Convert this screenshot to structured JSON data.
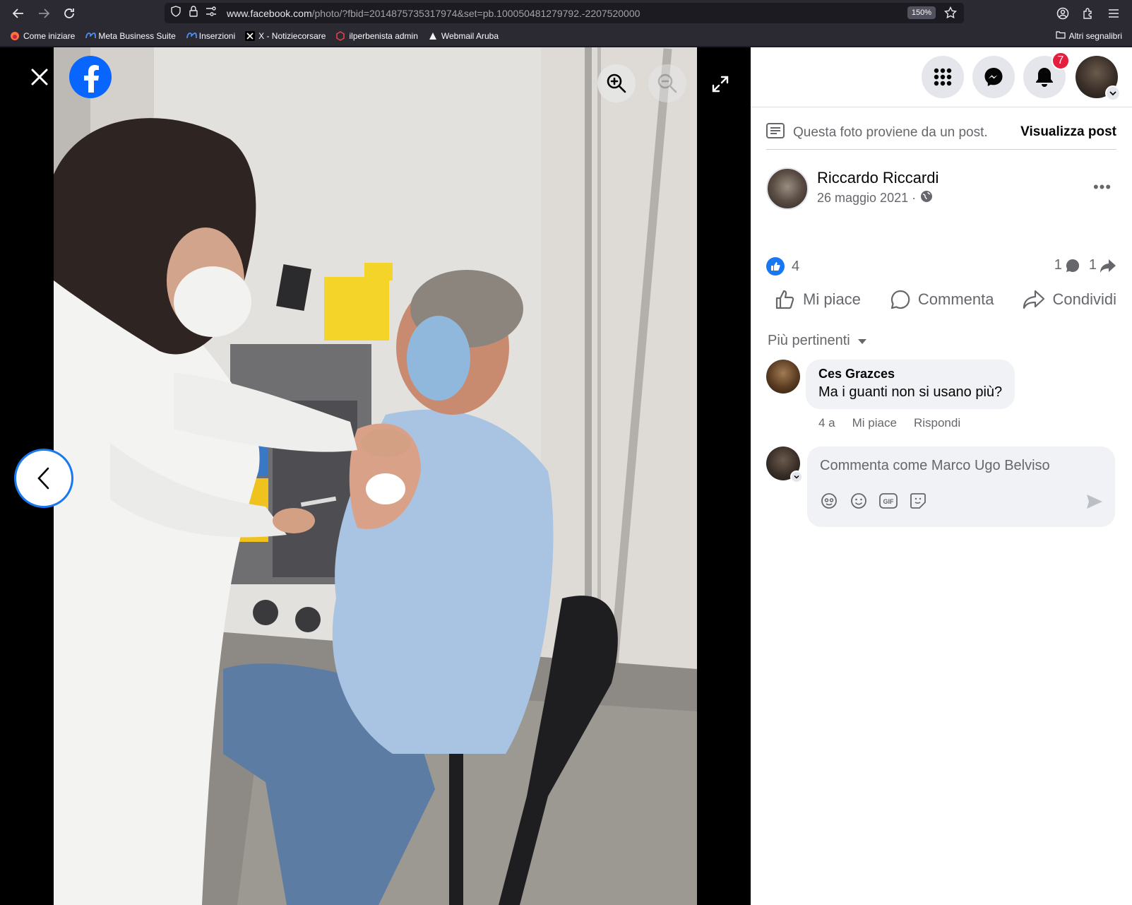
{
  "browser": {
    "url_host": "www.facebook.com",
    "url_path": "/photo/?fbid=2014875735317974&set=pb.100050481279792.-2207520000",
    "zoom": "150%",
    "bookmarks": [
      {
        "label": "Come iniziare"
      },
      {
        "label": "Meta Business Suite"
      },
      {
        "label": "Inserzioni"
      },
      {
        "label": "X - Notiziecorsare"
      },
      {
        "label": "ilperbenista admin"
      },
      {
        "label": "Webmail Aruba"
      }
    ],
    "other_bookmarks": "Altri segnalibri"
  },
  "viewer": {
    "photo_description_icon": "photo"
  },
  "topnav": {
    "notifications_count": "7"
  },
  "post": {
    "notice_text": "Questa foto proviene da un post.",
    "notice_link": "Visualizza post",
    "author_name": "Riccardo Riccardi",
    "date": "26 maggio 2021 ·",
    "more": "•••",
    "like_count": "4",
    "comment_count": "1",
    "share_count": "1",
    "actions": {
      "like": "Mi piace",
      "comment": "Commenta",
      "share": "Condividi"
    },
    "sort_label": "Più pertinenti"
  },
  "comments": [
    {
      "author": "Ces Grazces",
      "text": "Ma i guanti non si usano più?",
      "age": "4 a",
      "like": "Mi piace",
      "reply": "Rispondi"
    }
  ],
  "composer": {
    "placeholder": "Commenta come Marco Ugo Belviso"
  },
  "colors": {
    "facebook_blue": "#1877f2",
    "badge_red": "#e41e3f"
  }
}
